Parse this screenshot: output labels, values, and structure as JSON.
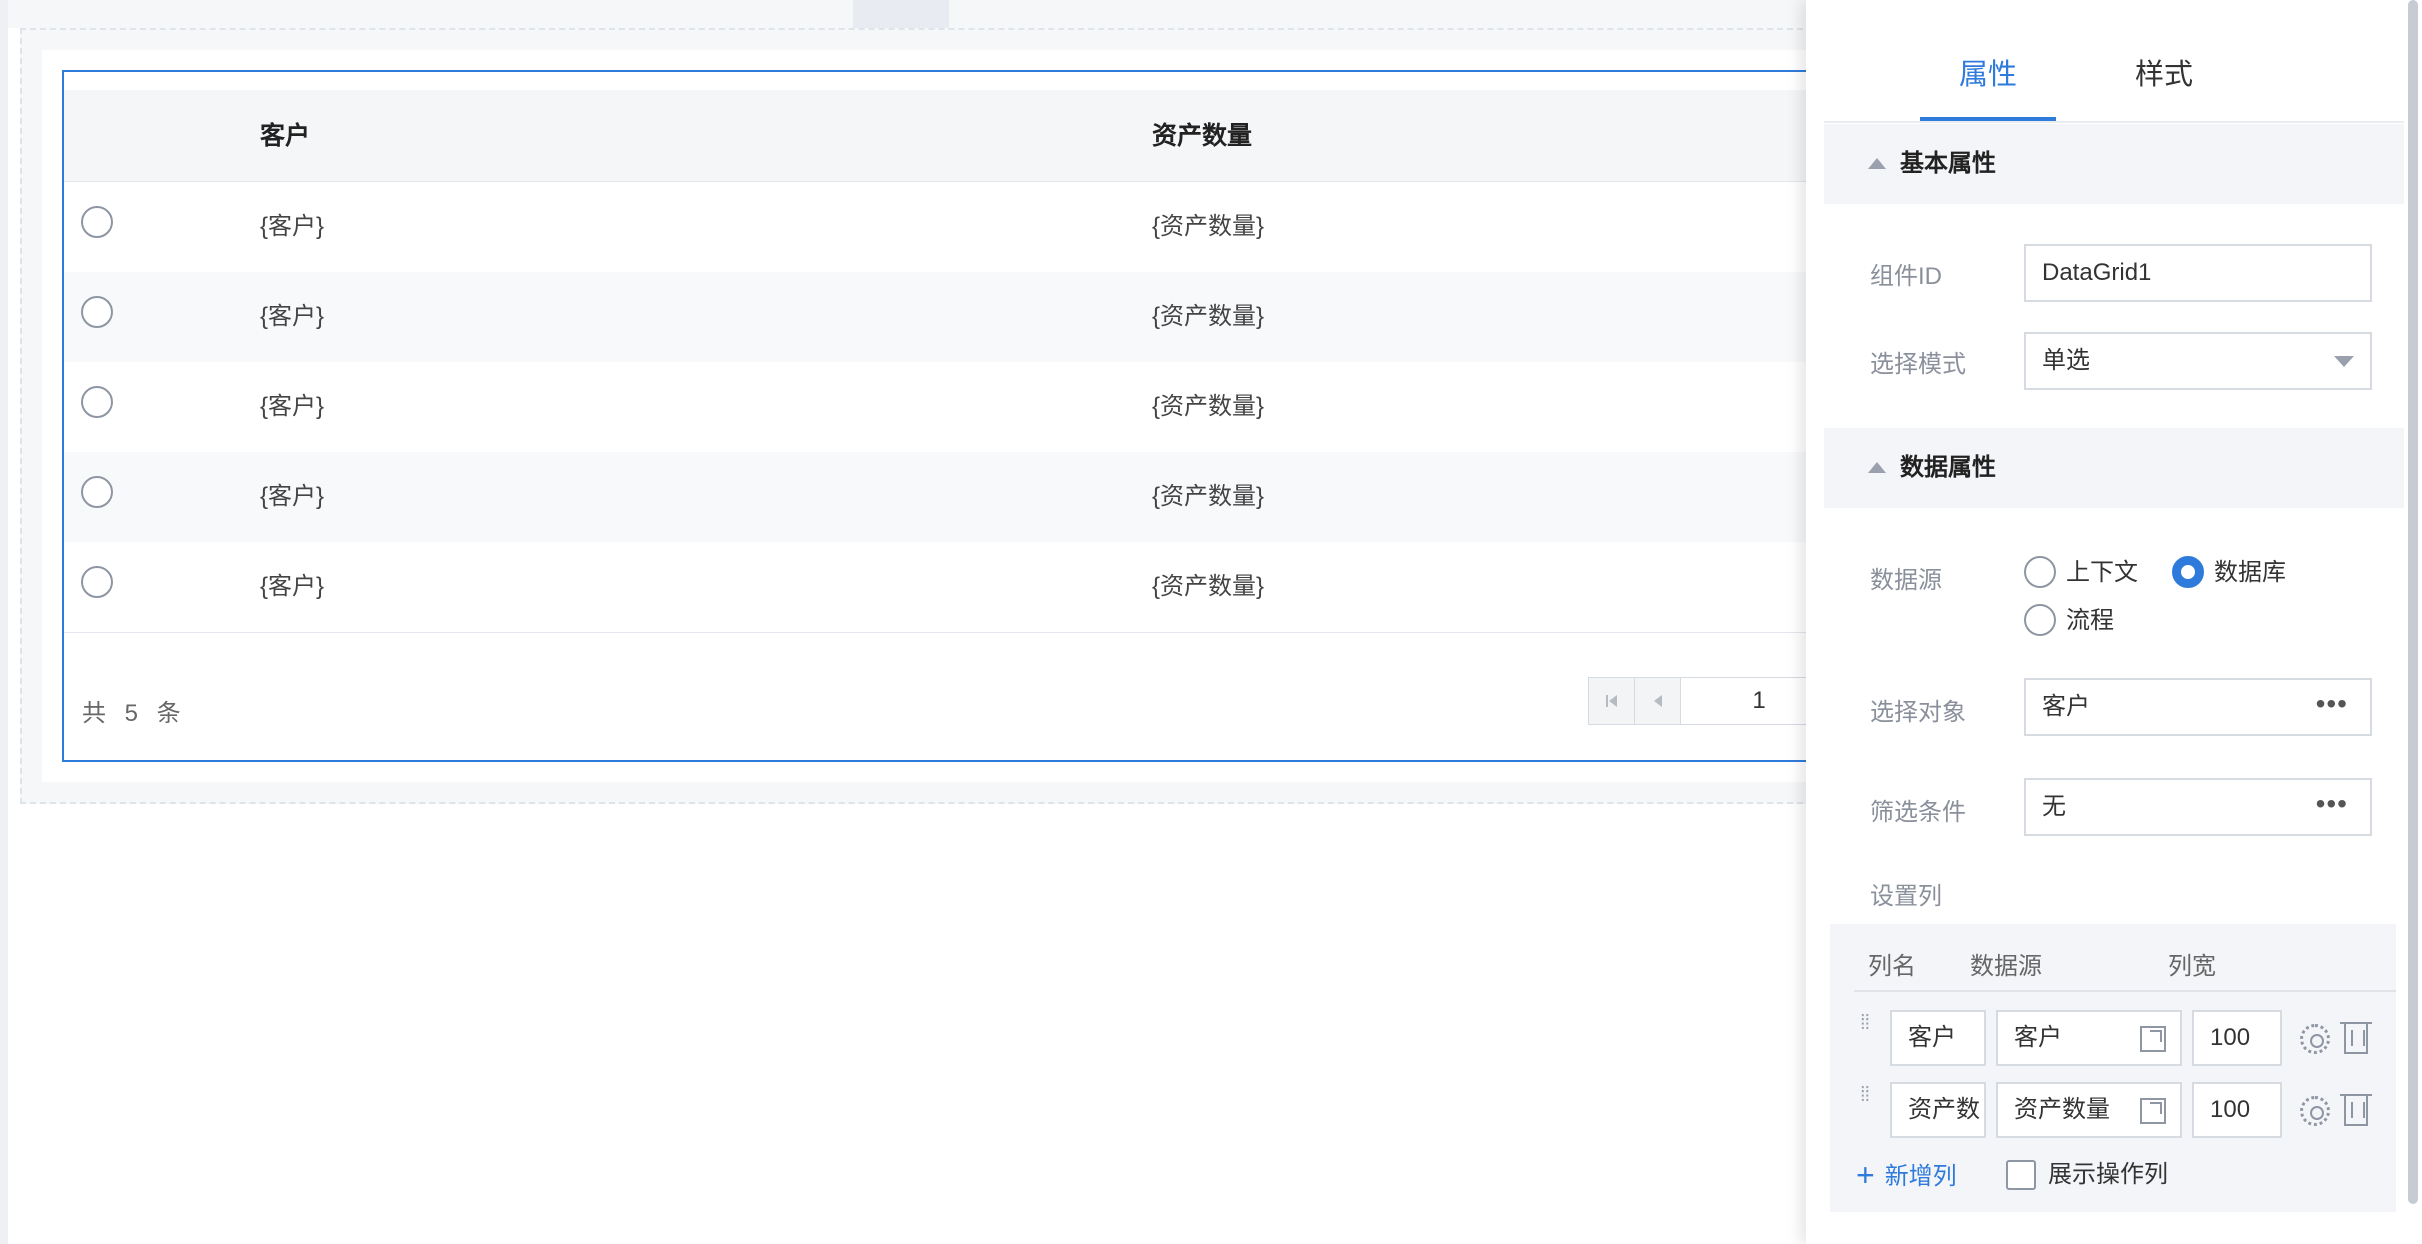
{
  "grid": {
    "columns": [
      "客户",
      "资产数量"
    ],
    "rows": [
      {
        "customer": "{客户}",
        "assets": "{资产数量}"
      },
      {
        "customer": "{客户}",
        "assets": "{资产数量}"
      },
      {
        "customer": "{客户}",
        "assets": "{资产数量}"
      },
      {
        "customer": "{客户}",
        "assets": "{资产数量}"
      },
      {
        "customer": "{客户}",
        "assets": "{资产数量}"
      }
    ],
    "total_text": "共 5 条",
    "current_page": "1"
  },
  "panel": {
    "tabs": [
      "属性",
      "样式"
    ],
    "active_tab": "属性",
    "basic": {
      "title": "基本属性",
      "component_id_label": "组件ID",
      "component_id_value": "DataGrid1",
      "select_mode_label": "选择模式",
      "select_mode_value": "单选"
    },
    "data": {
      "title": "数据属性",
      "source_label": "数据源",
      "source_options": [
        "上下文",
        "数据库",
        "流程"
      ],
      "source_selected": "数据库",
      "object_label": "选择对象",
      "object_value": "客户",
      "filter_label": "筛选条件",
      "filter_value": "无",
      "columns_label": "设置列",
      "columns_head": [
        "列名",
        "数据源",
        "列宽"
      ],
      "columns": [
        {
          "name": "客户",
          "source": "客户",
          "width": "100"
        },
        {
          "name": "资产数",
          "source": "资产数量",
          "width": "100"
        }
      ],
      "add_column": "新增列",
      "show_ops": "展示操作列"
    }
  },
  "colors": {
    "accent": "#2f7bdc",
    "header_bg": "#f5f6f8"
  }
}
